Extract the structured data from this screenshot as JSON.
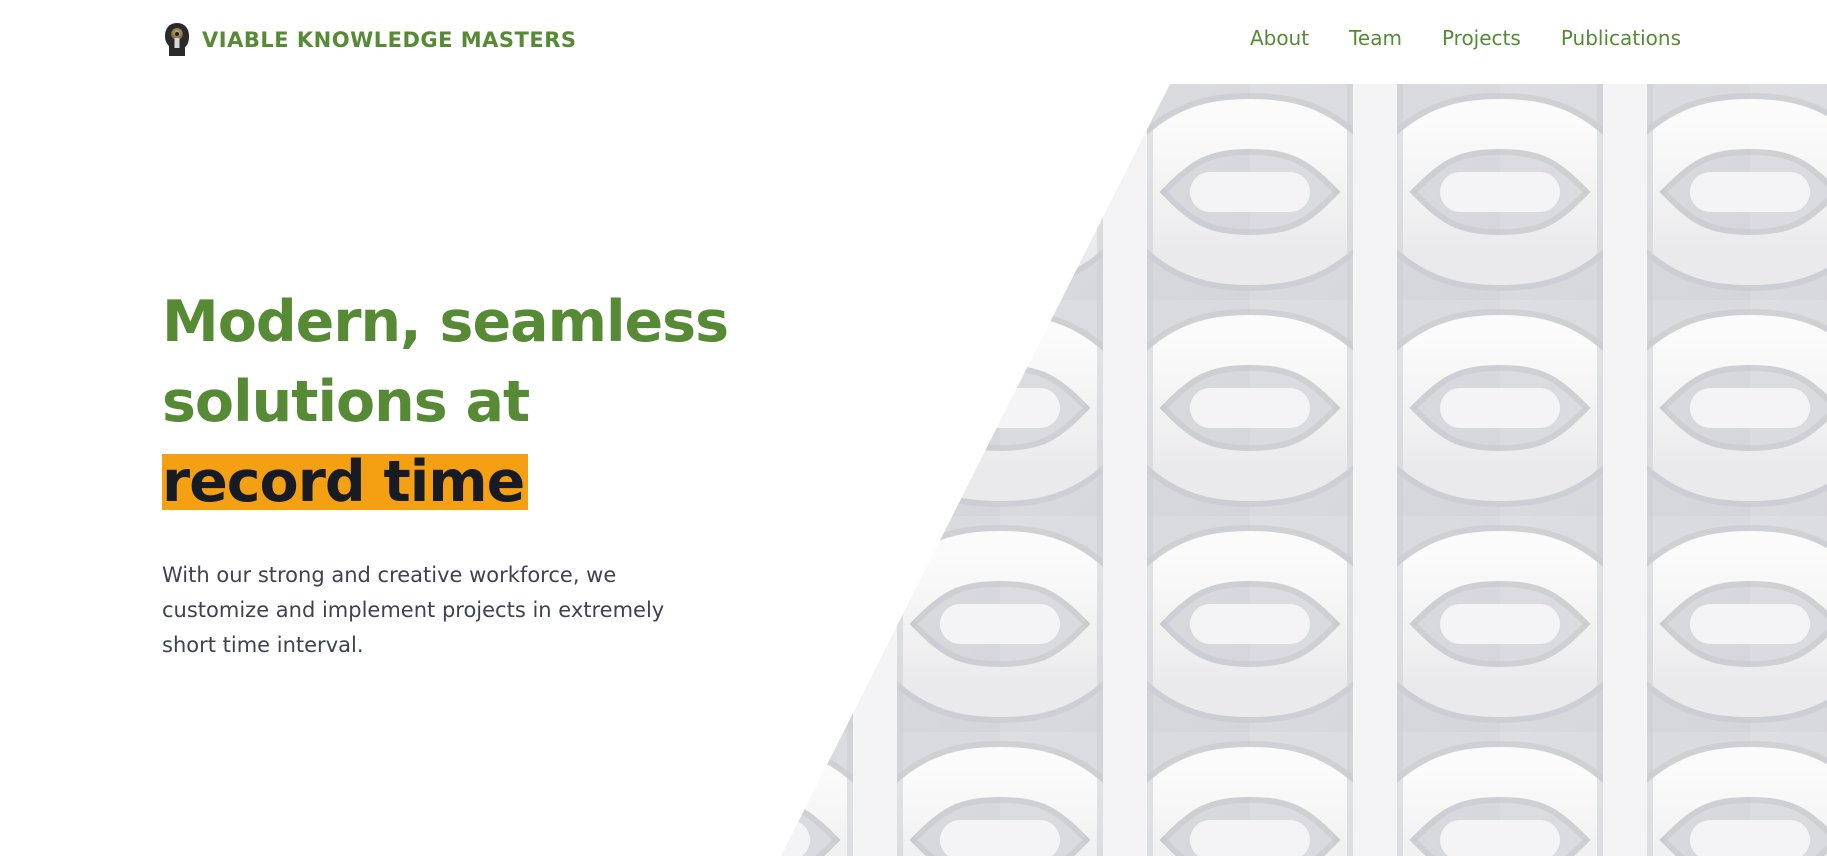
{
  "header": {
    "brand_name": "VIABLE KNOWLEDGE MASTERS",
    "logo_icon": "keyhole-head-icon",
    "nav": [
      {
        "label": "About"
      },
      {
        "label": "Team"
      },
      {
        "label": "Projects"
      },
      {
        "label": "Publications"
      }
    ]
  },
  "hero": {
    "title_line1": "Modern, seamless",
    "title_line2": "solutions at",
    "title_highlight": "record time",
    "description": "With our strong and creative workforce, we customize and implement projects in extremely short time interval.",
    "art_icon": "woven-lattice-pattern"
  },
  "colors": {
    "brand_green": "#568a35",
    "highlight_orange": "#f5a012",
    "highlight_text": "#161b26",
    "body_text": "#3d4350",
    "lattice_shadow": "#d3d5da",
    "lattice_light": "#f7f7f8"
  }
}
